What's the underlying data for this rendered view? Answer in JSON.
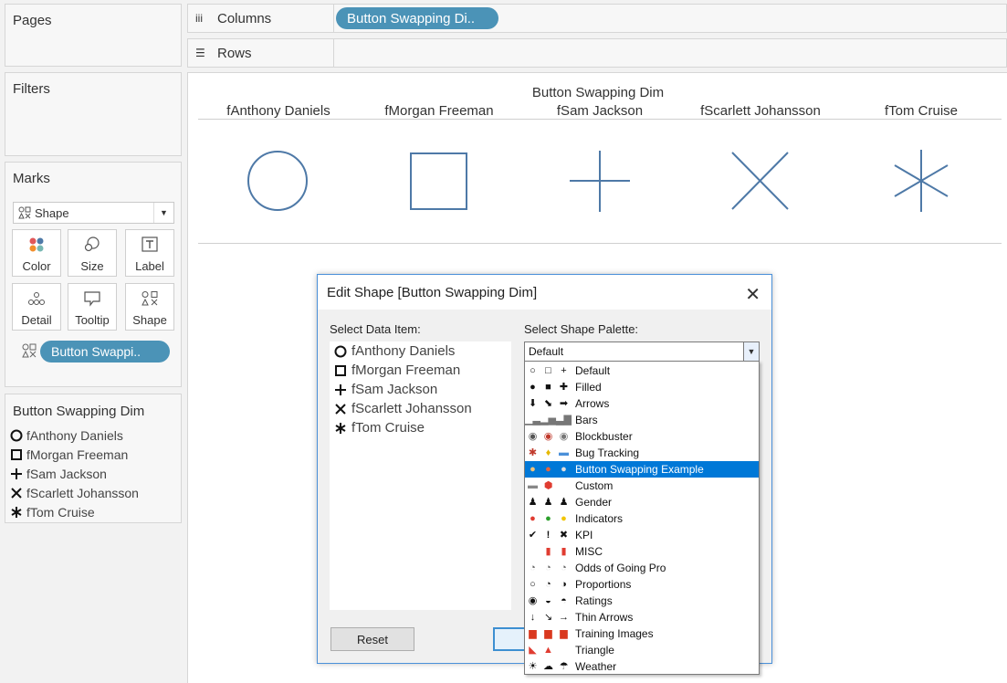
{
  "left_panel": {
    "pages_title": "Pages",
    "filters_title": "Filters",
    "marks_title": "Marks",
    "mark_type": "Shape",
    "mark_buttons": {
      "color": "Color",
      "size": "Size",
      "label": "Label",
      "detail": "Detail",
      "tooltip": "Tooltip",
      "shape": "Shape"
    },
    "marks_pill": "Button Swappi..",
    "legend_title": "Button Swapping Dim",
    "legend_items": [
      "fAnthony Daniels",
      "fMorgan Freeman",
      "fSam Jackson",
      "fScarlett Johansson",
      "fTom Cruise"
    ]
  },
  "shelves": {
    "columns_label": "Columns",
    "columns_pill": "Button Swapping Di..",
    "rows_label": "Rows"
  },
  "view": {
    "header_title": "Button Swapping Dim",
    "columns": [
      "fAnthony Daniels",
      "fMorgan Freeman",
      "fSam Jackson",
      "fScarlett Johansson",
      "fTom Cruise"
    ],
    "mark_color": "#4e79a7"
  },
  "dialog": {
    "title": "Edit Shape [Button Swapping Dim]",
    "select_data_item_label": "Select Data Item:",
    "select_palette_label": "Select Shape Palette:",
    "data_items": [
      "fAnthony Daniels",
      "fMorgan Freeman",
      "fSam Jackson",
      "fScarlett Johansson",
      "fTom Cruise"
    ],
    "palette_value": "Default",
    "reset_label": "Reset",
    "palette_options": [
      "Default",
      "Filled",
      "Arrows",
      "Bars",
      "Blockbuster",
      "Bug Tracking",
      "Button Swapping Example",
      "Custom",
      "Gender",
      "Indicators",
      "KPI",
      "MISC",
      "Odds of Going Pro",
      "Proportions",
      "Ratings",
      "Thin Arrows",
      "Training Images",
      "Triangle",
      "Weather"
    ],
    "highlighted_option": "Button Swapping Example",
    "highlight_color": "#0078d7"
  }
}
